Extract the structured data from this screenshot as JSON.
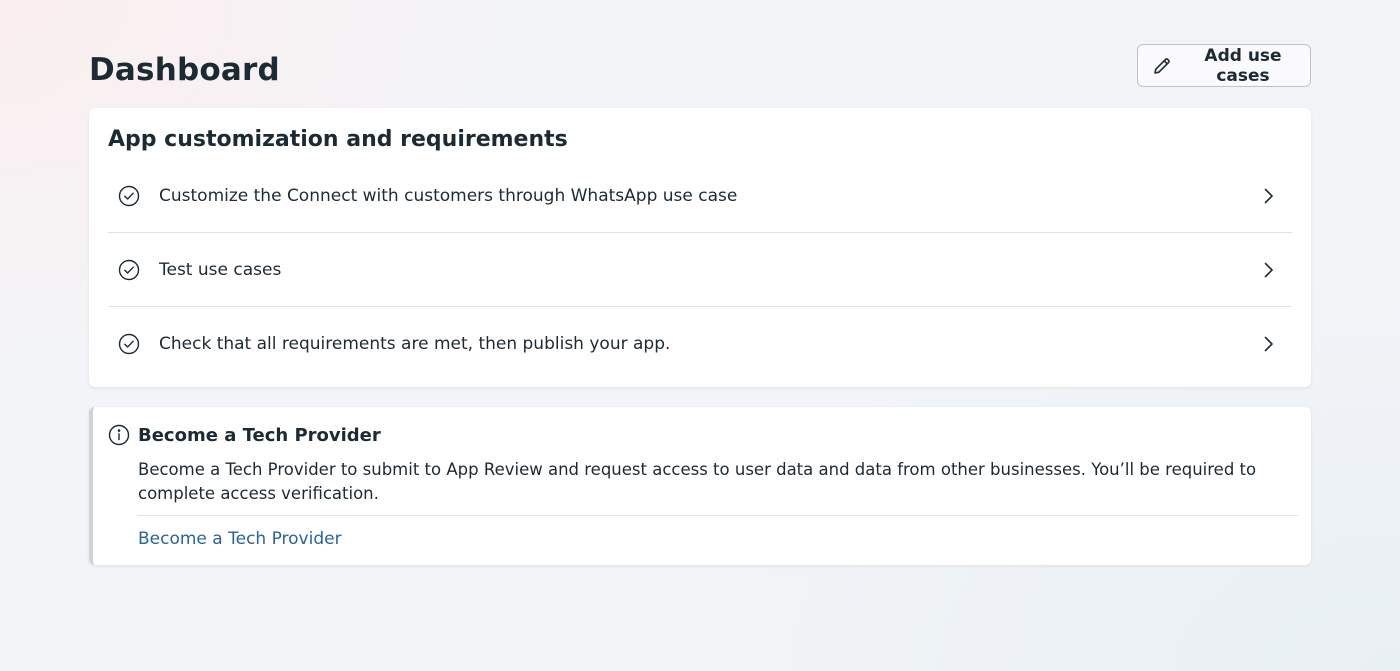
{
  "header": {
    "title": "Dashboard",
    "add_button_label": "Add use cases",
    "add_button_icon": "pencil-icon"
  },
  "requirements": {
    "title": "App customization and requirements",
    "items": [
      {
        "label": "Customize the Connect with customers through WhatsApp use case",
        "icon": "check-circle-icon"
      },
      {
        "label": "Test use cases",
        "icon": "check-circle-icon"
      },
      {
        "label": "Check that all requirements are met, then publish your app.",
        "icon": "check-circle-icon"
      }
    ]
  },
  "tech_provider": {
    "icon": "info-icon",
    "title": "Become a Tech Provider",
    "description": "Become a Tech Provider to submit to App Review and request access to user data and data from other businesses. You’ll be required to complete access verification.",
    "link_label": "Become a Tech Provider"
  },
  "colors": {
    "text": "#1c2b33",
    "link": "#2a6496",
    "divider": "#dde2e6",
    "accent_border": "#cfd4d8"
  }
}
